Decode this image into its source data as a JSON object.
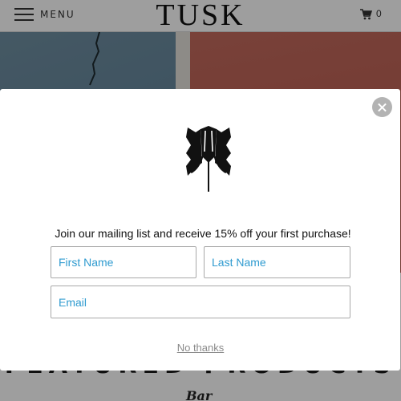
{
  "header": {
    "menu_label": "MENU",
    "brand": "TUSK",
    "cart_count": "0",
    "menu_icon": "hamburger-menu-icon",
    "cart_icon": "shopping-cart-icon"
  },
  "page": {
    "section_heading": "FEATURED PRODUCTS",
    "product_logo_text": "Bar"
  },
  "popup": {
    "logo": "tusk-elephant-logo",
    "message": "Join our mailing list and receive 15% off your first purchase!",
    "first_name_placeholder": "First Name",
    "last_name_placeholder": "Last Name",
    "email_placeholder": "Email",
    "dismiss_label": "No thanks",
    "close_icon": "close-icon"
  },
  "colors": {
    "field_placeholder": "#2f9bd0",
    "cta_button": "#6b1025",
    "close_button": "#b3b3b3"
  }
}
